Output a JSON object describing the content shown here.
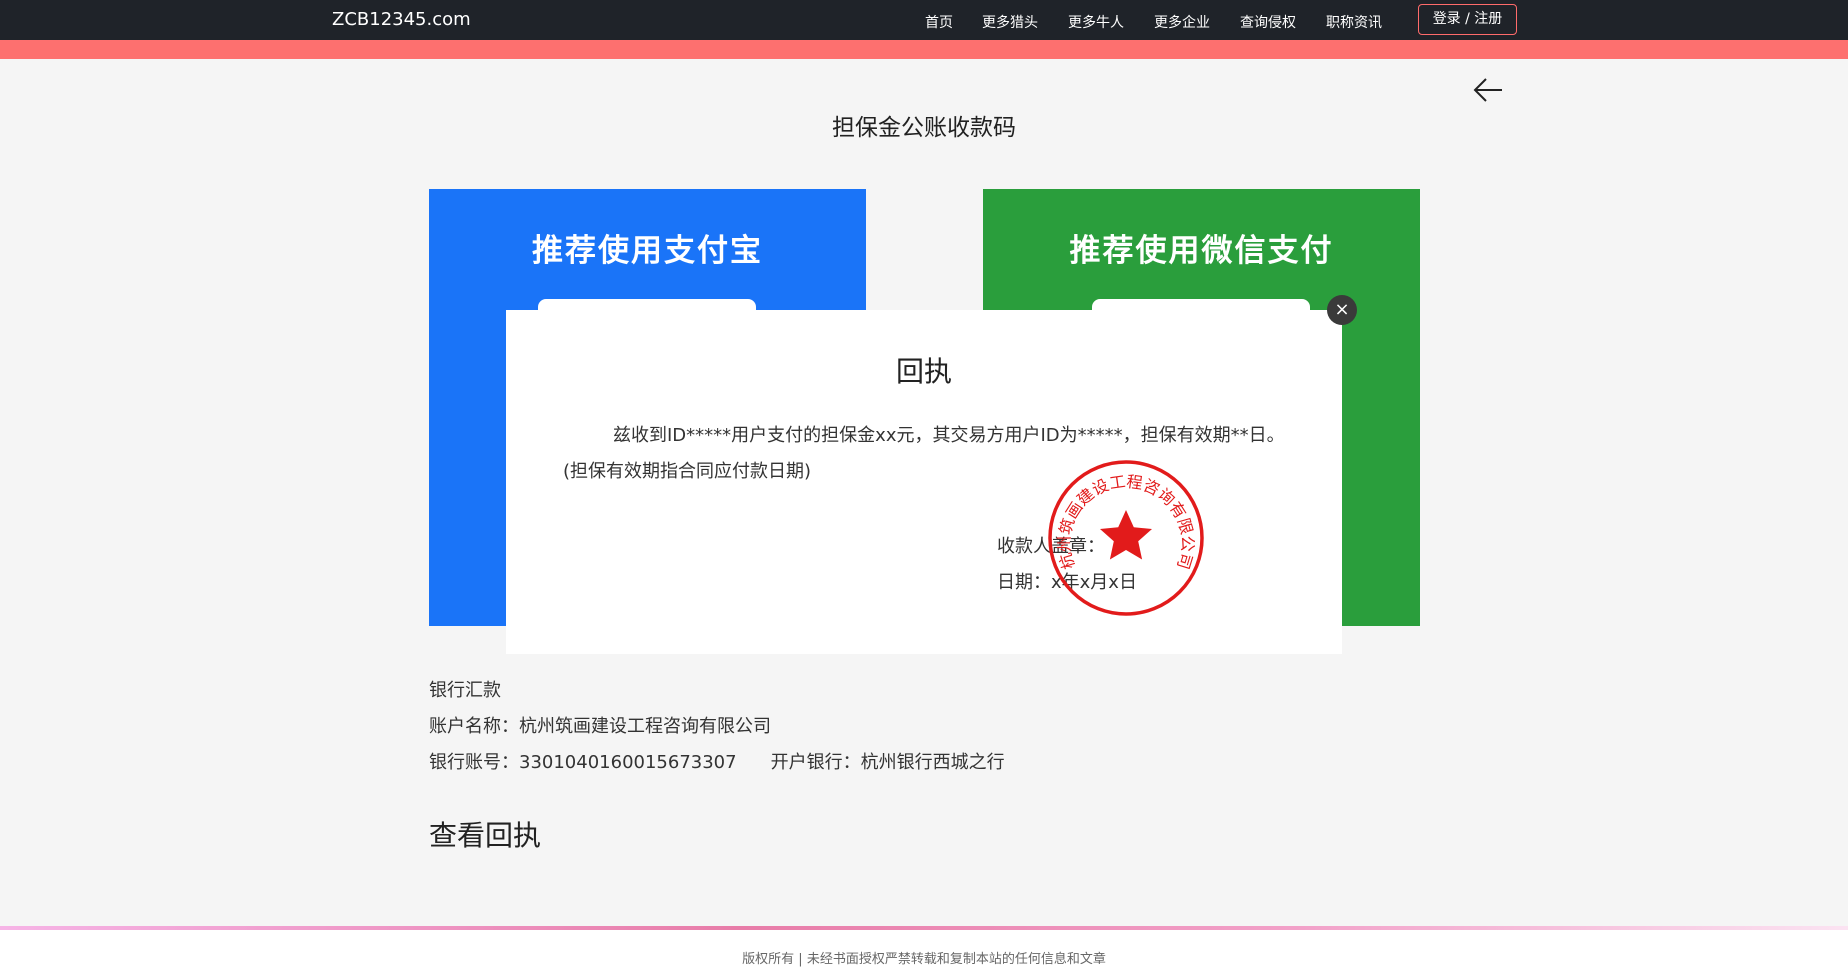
{
  "header": {
    "logo": "ZCB12345.com",
    "nav": [
      "首页",
      "更多猎头",
      "更多牛人",
      "更多企业",
      "查询侵权",
      "职称资讯"
    ],
    "login_label": "登录 / 注册"
  },
  "page": {
    "title": "担保金公账收款码"
  },
  "cards": {
    "alipay_title": "推荐使用支付宝",
    "wechat_title": "推荐使用微信支付"
  },
  "modal": {
    "close_glyph": "×",
    "title": "回执",
    "body_line1": "兹收到ID*****用户支付的担保金xx元，其交易方用户ID为*****，担保有效期**日。",
    "body_line2": "(担保有效期指合同应付款日期)",
    "payee_label": "收款人盖章：",
    "date_label": "日期：",
    "date_value": "x年x月x日",
    "stamp_text": "杭州筑画建设工程咨询有限公司"
  },
  "bank": {
    "heading": "银行汇款",
    "account_name_label": "账户名称：",
    "account_name": "杭州筑画建设工程咨询有限公司",
    "account_number_label": "银行账号：",
    "account_number": "3301040160015673307",
    "bank_label": "开户银行：",
    "bank_name": "杭州银行西城之行"
  },
  "view_receipt_label": "查看回执",
  "footer": {
    "text": "版权所有 | 未经书面授权严禁转载和复制本站的任何信息和文章"
  },
  "colors": {
    "nav_bg": "#1f2329",
    "accent": "#fd706f",
    "alipay": "#1a74f8",
    "wechat": "#2a9e3c",
    "stamp": "#e21b1b"
  }
}
